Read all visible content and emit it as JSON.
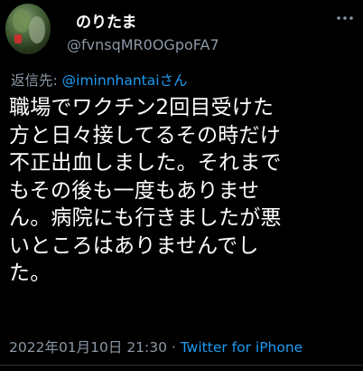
{
  "author": {
    "display_name": "のりたま",
    "handle": "@fvnsqMR0OGpoFA7"
  },
  "reply": {
    "prefix": "返信先: ",
    "target": "@iminnhantai",
    "suffix": "さん"
  },
  "body": {
    "lines": [
      "職場でワクチン2回目受けた",
      "方と日々接してるその時だけ",
      "不正出血しました。それまで",
      "もその後も一度もありませ",
      "ん。病院にも行きましたが悪",
      "いところはありませんでし",
      "た。"
    ]
  },
  "meta": {
    "timestamp": "2022年01月10日 21:30",
    "separator": " · ",
    "source": "Twitter for iPhone"
  },
  "colors": {
    "background": "#000000",
    "text": "#ffffff",
    "secondary": "#8b98a5",
    "link": "#1d9bf0"
  },
  "icons": {
    "more": "more-options-icon"
  }
}
